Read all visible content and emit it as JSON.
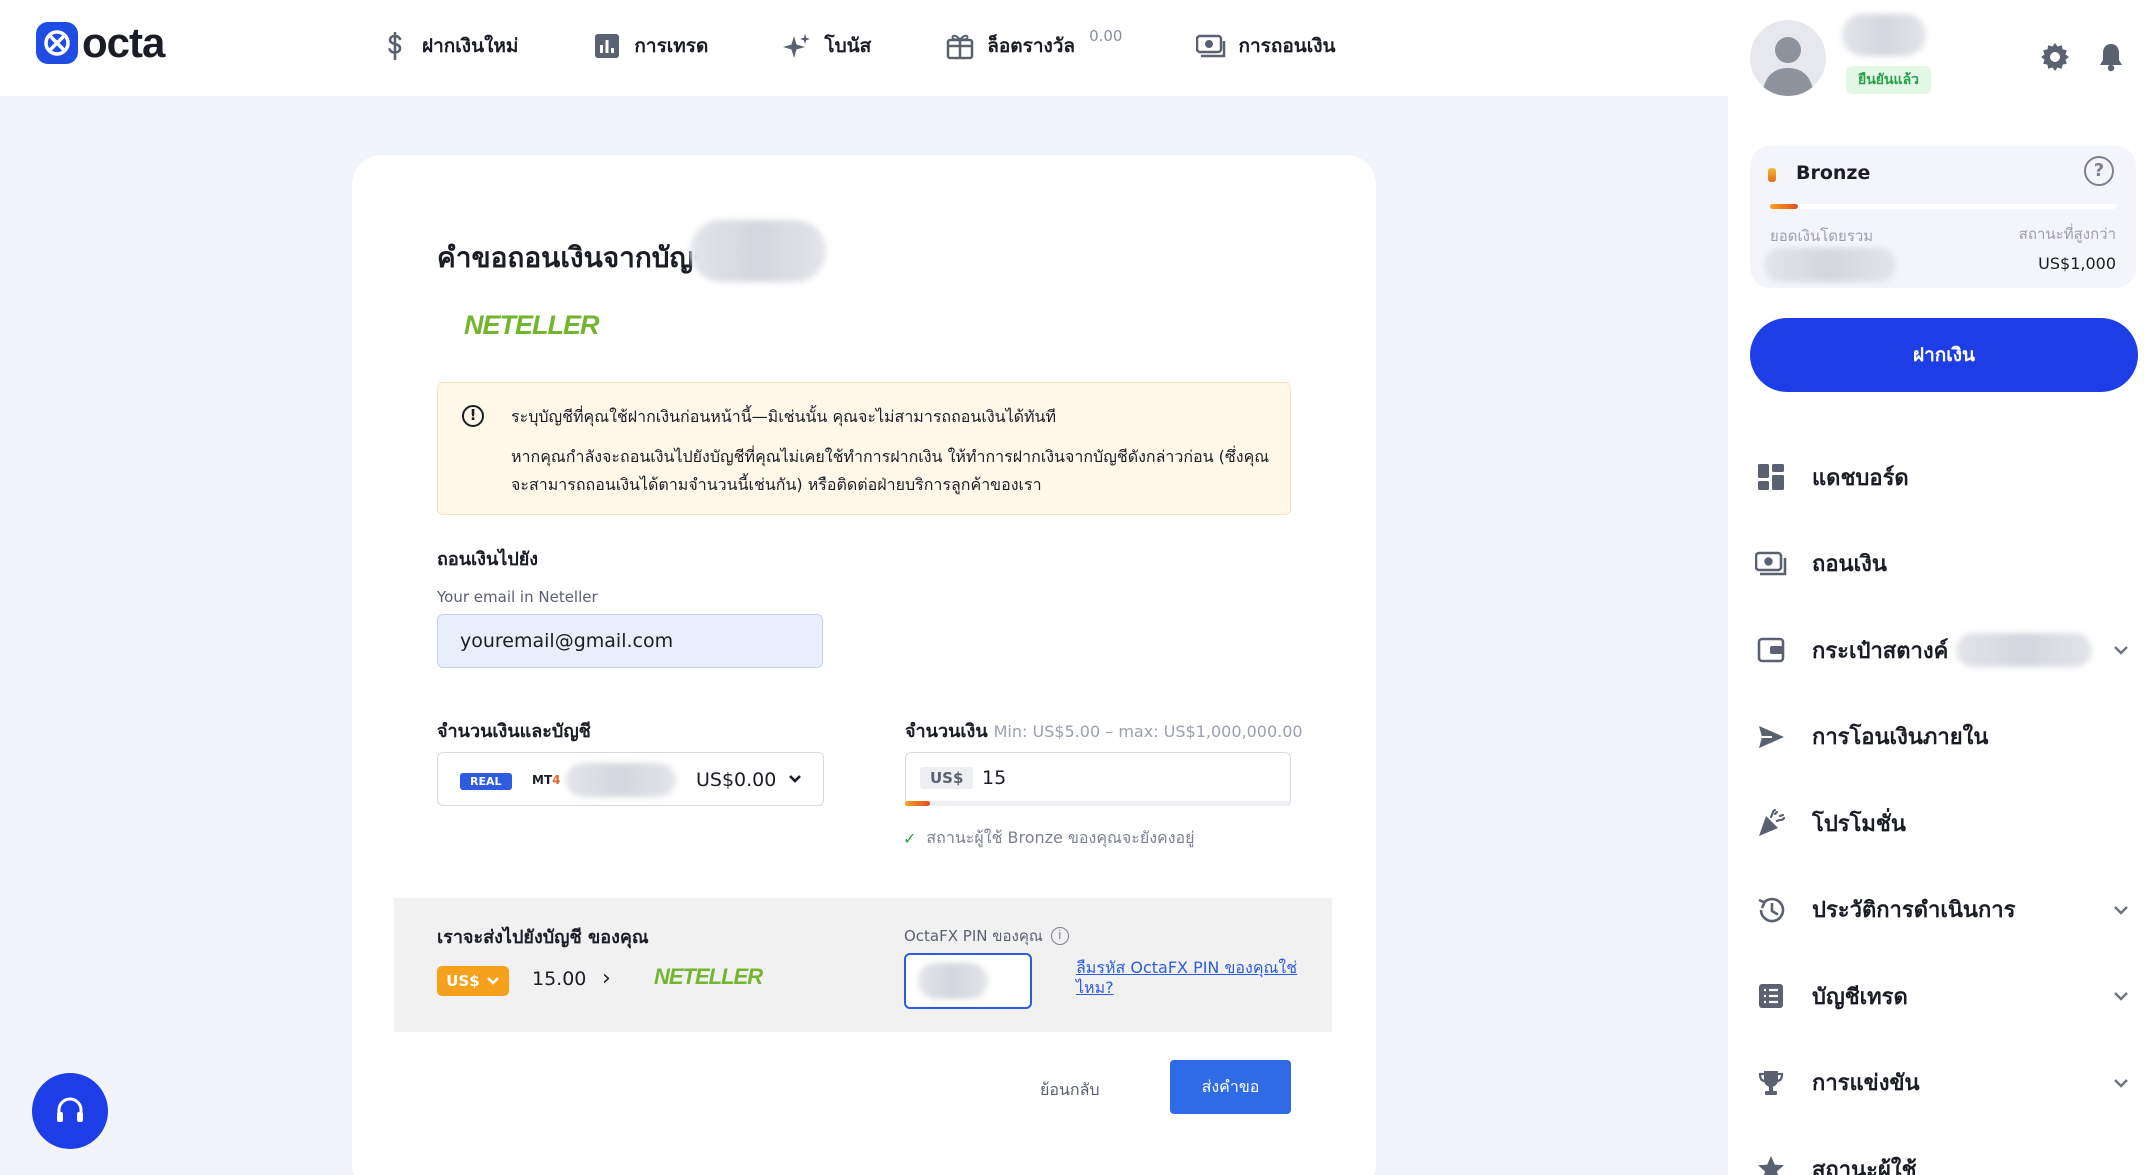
{
  "brand": {
    "name": "octa"
  },
  "topnav": {
    "items": [
      {
        "label": "ฝากเงินใหม่",
        "icon": "dollar-icon"
      },
      {
        "label": "การเทรด",
        "icon": "chart-icon"
      },
      {
        "label": "โบนัส",
        "icon": "sparkle-icon"
      },
      {
        "label": "ล็อตรางวัล",
        "icon": "gift-icon",
        "badge": "0.00"
      },
      {
        "label": "การถอนเงิน",
        "icon": "cash-icon"
      }
    ]
  },
  "user": {
    "verified": "ยืนยันแล้ว"
  },
  "tier": {
    "name": "Bronze",
    "help": "?",
    "total_label": "ยอดเงินโดยรวม",
    "next_label": "สถานะที่สูงกว่า",
    "next_value": "US$1,000",
    "progress_fraction": 0.08
  },
  "sidebar": {
    "deposit_button": "ฝากเงิน",
    "items": [
      {
        "label": "แดชบอร์ด",
        "icon": "dashboard-icon",
        "chevron": false
      },
      {
        "label": "ถอนเงิน",
        "icon": "cash-icon",
        "chevron": false
      },
      {
        "label": "กระเป๋าสตางค์",
        "icon": "wallet-icon",
        "chevron": true
      },
      {
        "label": "การโอนเงินภายใน",
        "icon": "send-icon",
        "chevron": false
      },
      {
        "label": "โปรโมชั่น",
        "icon": "party-icon",
        "chevron": false
      },
      {
        "label": "ประวัติการดำเนินการ",
        "icon": "history-icon",
        "chevron": true
      },
      {
        "label": "บัญชีเทรด",
        "icon": "list-icon",
        "chevron": true
      },
      {
        "label": "การแข่งขัน",
        "icon": "trophy-icon",
        "chevron": true
      },
      {
        "label": "สถานะผู้ใช้",
        "icon": "star-icon",
        "chevron": false
      }
    ]
  },
  "form": {
    "title": "คำขอถอนเงินจากบัญชี",
    "method_logo": "NETELLER",
    "warning": {
      "line1": "ระบุบัญชีที่คุณใช้ฝากเงินก่อนหน้านี้—มิเช่นนั้น คุณจะไม่สามารถถอนเงินได้ทันที",
      "line2": "หากคุณกำลังจะถอนเงินไปยังบัญชีที่คุณไม่เคยใช้ทำการฝากเงิน ให้ทำการฝากเงินจากบัญชีดังกล่าวก่อน (ซึ่งคุณจะสามารถถอนเงินได้ตามจำนวนนี้เช่นกัน) หรือติดต่อฝ่ายบริการลูกค้าของเรา"
    },
    "withdraw_to_label": "ถอนเงินไปยัง",
    "email_label": "Your email in Neteller",
    "email_value": "youremail@gmail.com",
    "account_section_label": "จำนวนเงินและบัญชี",
    "account": {
      "type": "REAL",
      "platform_prefix": "MT",
      "platform_num": "4",
      "balance": "US$0.00"
    },
    "amount_label": "จำนวนเงิน",
    "amount_range": "Min: US$5.00 – max: US$1,000,000.00",
    "currency": "US$",
    "amount_value": "15",
    "amount_progress_fraction": 0.065,
    "status_note": "สถานะผู้ใช้ Bronze ของคุณจะยังคงอยู่",
    "summary": {
      "title": "เราจะส่งไปยังบัญชี ของคุณ",
      "currency": "US$",
      "amount": "15.00",
      "arrow": "›",
      "method": "NETELLER",
      "pin_label": "OctaFX PIN ของคุณ",
      "pin_info": "i",
      "forgot_link": "ลืมรหัส OctaFX PIN ของคุณใช่ไหม?"
    },
    "back_button": "ย้อนกลับ",
    "submit_button": "ส่งคำขอ"
  },
  "colors": {
    "primary": "#1d3ee6",
    "accent_orange": "#f6a11b",
    "neteller_green": "#74b530",
    "success": "#27a04a"
  }
}
